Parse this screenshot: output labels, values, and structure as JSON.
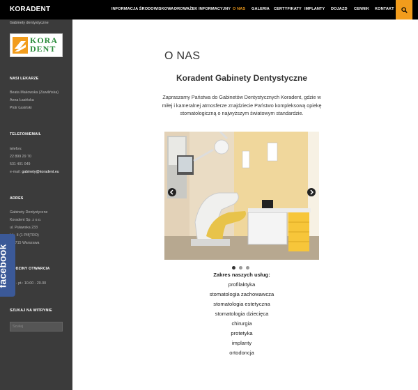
{
  "header": {
    "site_title": "KORADENT",
    "nav": [
      {
        "label": "INFORMACJA ŚRODOWISKOWA",
        "active": false
      },
      {
        "label": "DROWAŻEK INFORMACYJNY",
        "active": false
      },
      {
        "label": "O NAS",
        "active": true
      },
      {
        "label": "GALERIA",
        "active": false
      },
      {
        "label": "CERTYFIKATY",
        "active": false
      },
      {
        "label": "IMPLANTY",
        "active": false
      },
      {
        "label": "DOJAZD",
        "active": false
      },
      {
        "label": "CENNIK",
        "active": false
      },
      {
        "label": "KONTAKT",
        "active": false
      }
    ],
    "search_icon": "search-icon"
  },
  "sidebar": {
    "tagline": "Gabinety dentystyczne",
    "logo_text_1": "KORA",
    "logo_text_2": "DENT",
    "doctors": {
      "heading": "NASI LEKARZE",
      "names": [
        "Beata Makowska (Zawilińska)",
        "Anna Łasińska",
        "Piotr Łasiński"
      ]
    },
    "phone": {
      "heading": "TELEFON/EMAIL",
      "label": "telefon:",
      "numbers": [
        "22 899 29 70",
        "531 401 049"
      ],
      "email_prefix": "e-mail: ",
      "email": "gabinety@koradent.eu"
    },
    "address": {
      "heading": "ADRES",
      "lines": [
        "Gabinety Dentystyczne",
        "Koradent Sp. z o.o.",
        "ul. Puławska 233",
        "lok. II (1 PIĘTRO)",
        "02-715 Warszawa"
      ]
    },
    "hours": {
      "heading": "GODZINY OTWARCIA",
      "line": "pn. - pt.: 10.00 - 20.00"
    },
    "search": {
      "heading": "SZUKAJ NA WITRYNIE",
      "placeholder": "Szukaj"
    },
    "facebook_label": "facebook"
  },
  "main": {
    "page_title": "O NAS",
    "subtitle": "Koradent Gabinety Dentystyczne",
    "intro": "Zapraszamy Państwa do Gabinetów Dentystycznych Koradent, gdzie w miłej i kameralnej atmosferze znajdziecie Państwo kompleksową opiekę stomatologiczną o najwyższym światowym standardzie.",
    "slider": {
      "slide_count": 3,
      "active_slide": 1,
      "prev_icon": "arrow-left-icon",
      "next_icon": "arrow-right-icon"
    },
    "services_title": "Zakres naszych usług:",
    "services": [
      "profilaktyka",
      "stomatologia zachowawcza",
      "stomatologia estetyczna",
      "stomatologia dziecięca",
      "chirurgia",
      "protetyka",
      "implanty",
      "ortodoncja"
    ]
  },
  "colors": {
    "accent": "#f29c1c",
    "sidebar": "#3b3b3b",
    "topbar": "#000000",
    "facebook": "#3b5998",
    "logo_green": "#2c8c3c"
  }
}
